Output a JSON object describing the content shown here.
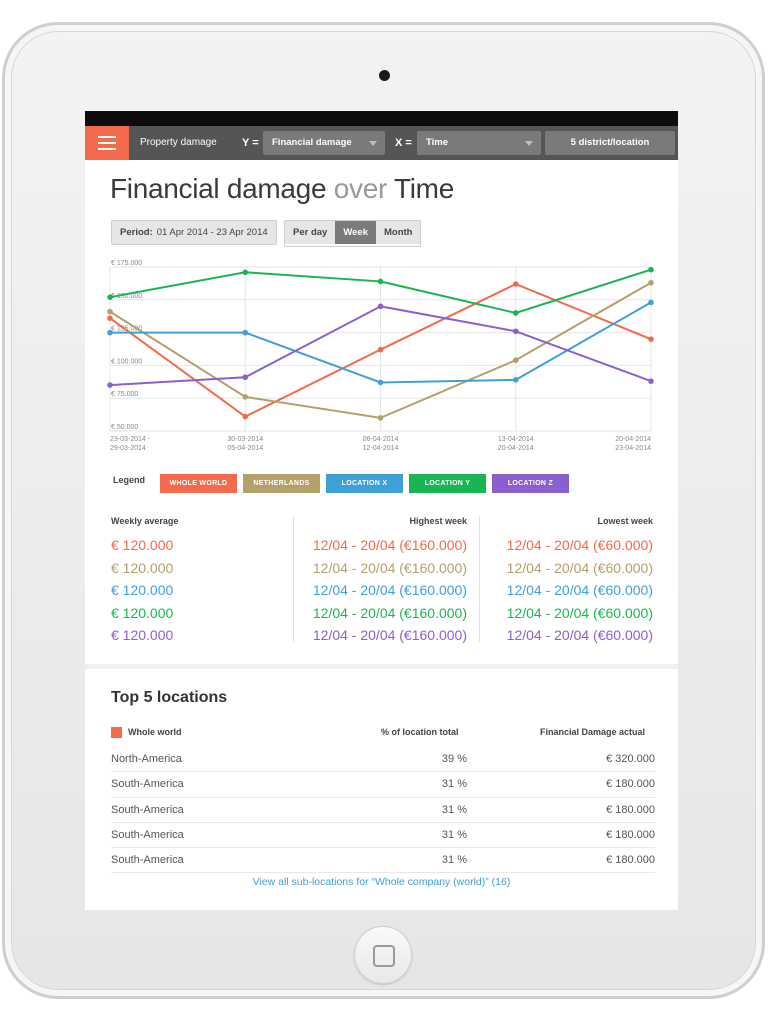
{
  "header": {
    "dataset": "Property damage",
    "y_prefix": "Y =",
    "y_value": "Financial damage",
    "x_prefix": "X =",
    "x_value": "Time",
    "location_button": "5 district/location"
  },
  "title": {
    "part1": "Financial damage",
    "part2": "over",
    "part3": "Time"
  },
  "period": {
    "label": "Period:",
    "value": "01 Apr 2014 - 23 Apr 2014"
  },
  "granularity": {
    "options": [
      "Per day",
      "Week",
      "Month"
    ],
    "selected": "Week"
  },
  "chart_data": {
    "type": "line",
    "x": [
      "23-03-2014 - 29-03-2014",
      "30-03-2014 05-04-2014",
      "06-04-2014 12-04-2014",
      "13-04-2014 20-04-2014",
      "20-04-2014 23-04-2014"
    ],
    "x_tick_lines": [
      [
        "23-03-2014 -",
        "29-03-2014"
      ],
      [
        "30-03-2014",
        "05-04-2014"
      ],
      [
        "06-04-2014",
        "12-04-2014"
      ],
      [
        "13-04-2014",
        "20-04-2014"
      ],
      [
        "20-04-2014",
        "23-04-2014"
      ]
    ],
    "y_ticks": [
      "€ 175.000",
      "€ 150.000",
      "€ 125.000",
      "€ 100.000",
      "€ 75.000",
      "€ 50.000"
    ],
    "ylim": [
      50000,
      175000
    ],
    "grid": true,
    "series": [
      {
        "name": "WHOLE WORLD",
        "color": "#f26a4b",
        "values": [
          136000,
          61000,
          112000,
          162000,
          120000
        ]
      },
      {
        "name": "NETHERLANDS",
        "color": "#b3a06a",
        "values": [
          141000,
          76000,
          60000,
          104000,
          163000
        ]
      },
      {
        "name": "LOCATION X",
        "color": "#3fa0d8",
        "values": [
          125000,
          125000,
          87000,
          89000,
          148000
        ]
      },
      {
        "name": "LOCATION Y",
        "color": "#1ab553",
        "values": [
          152000,
          171000,
          164000,
          140000,
          173000
        ]
      },
      {
        "name": "LOCATION Z",
        "color": "#8a5fd0",
        "values": [
          85000,
          91000,
          145000,
          126000,
          88000
        ]
      }
    ]
  },
  "legend_label": "Legend",
  "stats": {
    "weekly_heading": "Weekly average",
    "highest_heading": "Highest week",
    "lowest_heading": "Lowest week",
    "rows": [
      {
        "avg": "€ 120.000",
        "highest": "12/04 - 20/04 (€160.000)",
        "lowest": "12/04 - 20/04 (€60.000)",
        "color": "#f26a4b"
      },
      {
        "avg": "€ 120.000",
        "highest": "12/04 - 20/04 (€160.000)",
        "lowest": "12/04 - 20/04 (€60.000)",
        "color": "#b3a06a"
      },
      {
        "avg": "€ 120.000",
        "highest": "12/04 - 20/04 (€160.000)",
        "lowest": "12/04 - 20/04 (€60.000)",
        "color": "#3fa0d8"
      },
      {
        "avg": "€ 120.000",
        "highest": "12/04 - 20/04 (€160.000)",
        "lowest": "12/04 - 20/04 (€60.000)",
        "color": "#1ab553"
      },
      {
        "avg": "€ 120.000",
        "highest": "12/04 - 20/04 (€160.000)",
        "lowest": "12/04 - 20/04 (€60.000)",
        "color": "#8a5fd0"
      }
    ]
  },
  "locations": {
    "title": "Top 5 locations",
    "group_label": "Whole world",
    "col_pct": "% of location total",
    "col_damage": "Financial Damage actual",
    "rows": [
      {
        "name": "North-America",
        "pct": "39 %",
        "damage": "€ 320.000"
      },
      {
        "name": "South-America",
        "pct": "31 %",
        "damage": "€ 180.000"
      },
      {
        "name": "South-America",
        "pct": "31 %",
        "damage": "€ 180.000"
      },
      {
        "name": "South-America",
        "pct": "31 %",
        "damage": "€ 180.000"
      },
      {
        "name": "South-America",
        "pct": "31 %",
        "damage": "€ 180.000"
      }
    ],
    "view_all": "View all sub-locations for “Whole company (world)”  (16)"
  }
}
